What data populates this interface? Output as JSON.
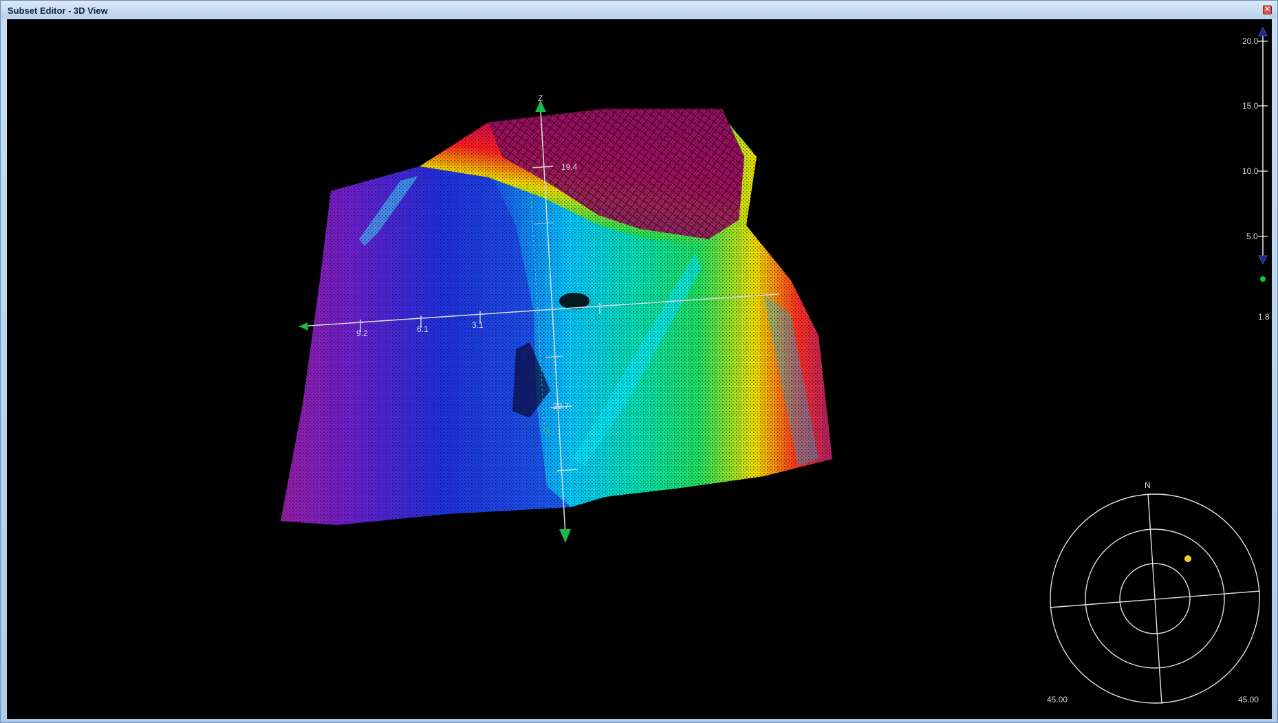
{
  "window": {
    "title": "Subset Editor - 3D View",
    "close_glyph": "×"
  },
  "axes": {
    "z_label": "Z",
    "x_ticks": [
      "9.2",
      "6.1",
      "3.1"
    ],
    "depth_ticks": [
      "19.4",
      "29.7"
    ]
  },
  "scale_bar": {
    "ticks": [
      "20.0",
      "15.0",
      "10.0",
      "5.0"
    ],
    "current_value": "1.8",
    "colors": {
      "line": "#ffffff",
      "top_arrow": "#1c2a8c",
      "bottom_arrow": "#1c2a8c",
      "handle": "#00cc33"
    }
  },
  "compass": {
    "north_label": "N",
    "left_angle": "45.00",
    "right_angle": "45.00",
    "sun_color": "#f0d020"
  },
  "point_cloud": {
    "colormap": [
      "#b0006a",
      "#6a20d0",
      "#2030e0",
      "#00c8ff",
      "#20e060",
      "#f0e000",
      "#ff2020",
      "#b0206a"
    ]
  }
}
